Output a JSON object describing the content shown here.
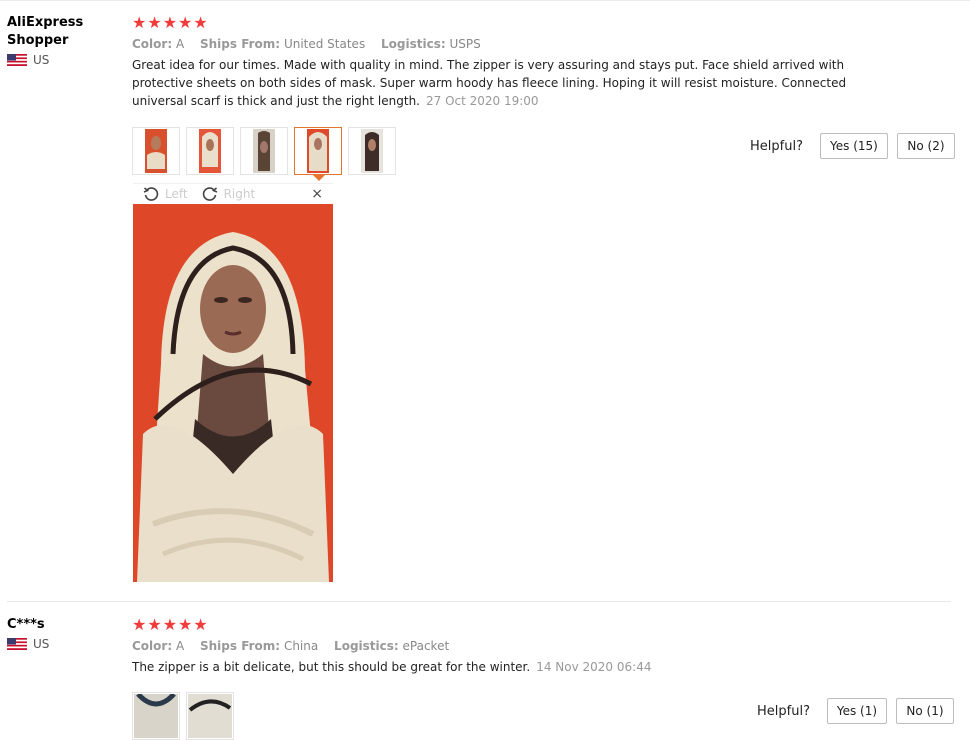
{
  "reviews": [
    {
      "reviewer": "AliExpress Shopper",
      "country": "US",
      "rating": 5,
      "meta": {
        "color_label": "Color:",
        "color_value": "A",
        "ships_label": "Ships From:",
        "ships_value": "United States",
        "logistics_label": "Logistics:",
        "logistics_value": "USPS"
      },
      "text": "Great idea for our times. Made with quality in mind. The zipper is very assuring and stays put. Face shield arrived with protective sheets on both sides of mask. Super warm hoody has fleece lining. Hoping it will resist moisture. Connected universal scarf is thick and just the right length.",
      "date": "27 Oct 2020 19:00",
      "thumbnail_count": 5,
      "active_thumbnail": 4,
      "helpful": {
        "label": "Helpful?",
        "yes": "Yes (15)",
        "no": "No (2)"
      },
      "viewer": {
        "rotate_left": "Left",
        "rotate_right": "Right",
        "close": "×"
      }
    },
    {
      "reviewer": "C***s",
      "country": "US",
      "rating": 5,
      "meta": {
        "color_label": "Color:",
        "color_value": "A",
        "ships_label": "Ships From:",
        "ships_value": "China",
        "logistics_label": "Logistics:",
        "logistics_value": "ePacket"
      },
      "text": "The zipper is a bit delicate, but this should be great for the winter.",
      "date": "14 Nov 2020 06:44",
      "thumbnail_count": 2,
      "helpful": {
        "label": "Helpful?",
        "yes": "Yes (1)",
        "no": "No (1)"
      }
    }
  ],
  "icons": {
    "star": "star-icon",
    "flag": "us-flag-icon",
    "rotate_left": "rotate-left-icon",
    "rotate_right": "rotate-right-icon",
    "close": "close-icon"
  },
  "colors": {
    "star": "#f23c3c",
    "active_thumb_border": "#e7742d",
    "photo_background": "#e04a2a"
  }
}
